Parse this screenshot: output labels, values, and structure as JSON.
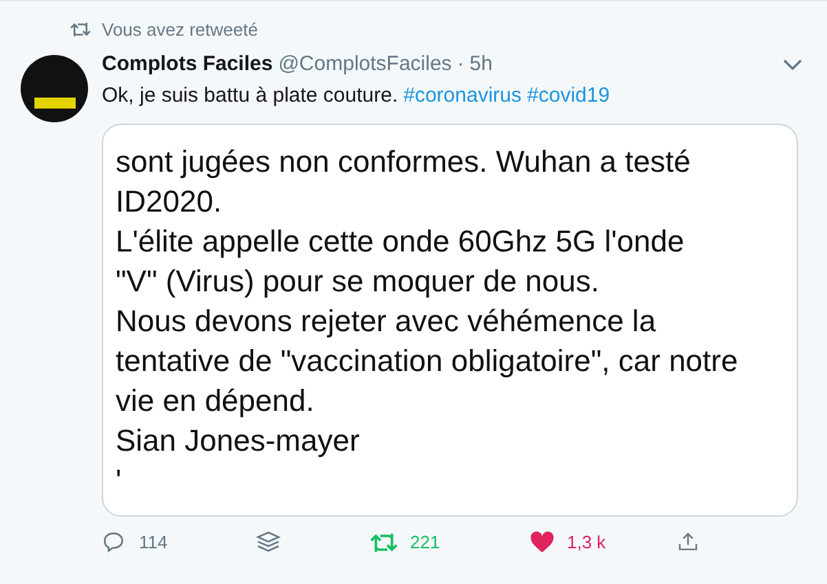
{
  "retweet_context": {
    "label": "Vous avez retweeté"
  },
  "tweet": {
    "name": "Complots Faciles",
    "handle": "@ComplotsFaciles",
    "separator": "·",
    "time": "5h",
    "text": "Ok, je suis battu à plate couture.",
    "hashtags": [
      "#coronavirus",
      "#covid19"
    ]
  },
  "image_text": [
    "sont jugées non conformes. Wuhan a testé",
    "ID2020.",
    "L'élite appelle cette onde 60Ghz 5G l'onde",
    "\"V\" (Virus) pour se moquer de nous.",
    "Nous devons rejeter avec véhémence la",
    "tentative de \"vaccination obligatoire\", car notre",
    "vie en dépend.",
    "Sian Jones-mayer",
    "'"
  ],
  "actions": {
    "replies": "114",
    "retweets": "221",
    "retweeted": true,
    "likes": "1,3 k",
    "liked": true
  }
}
